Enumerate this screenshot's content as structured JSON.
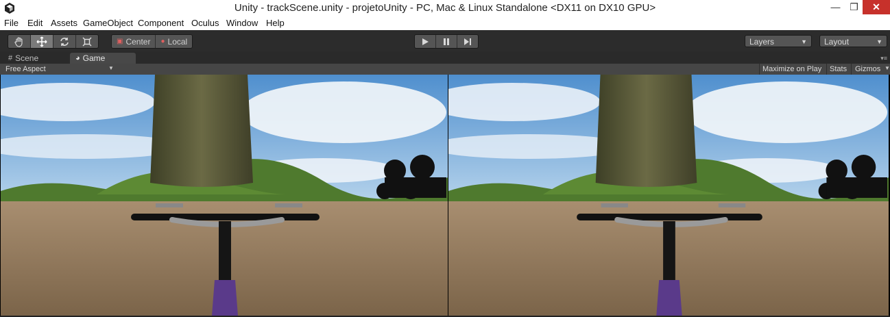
{
  "window": {
    "title": "Unity - trackScene.unity - projetoUnity - PC, Mac & Linux Standalone <DX11 on DX10 GPU>",
    "controls": [
      "minimize-icon",
      "maximize-icon",
      "close-icon"
    ]
  },
  "menu": {
    "items": [
      "File",
      "Edit",
      "Assets",
      "GameObject",
      "Component",
      "Oculus",
      "Window",
      "Help"
    ]
  },
  "toolbar": {
    "tools": [
      "hand-icon",
      "move-icon",
      "rotate-icon",
      "scale-icon"
    ],
    "active_tool": "move-icon",
    "pivot": "Center",
    "space": "Local",
    "playback": [
      "play-icon",
      "pause-icon",
      "step-icon"
    ],
    "layers": "Layers",
    "layout": "Layout"
  },
  "tabs": [
    {
      "label": "Scene",
      "icon": "grid-icon"
    },
    {
      "label": "Game",
      "icon": "pacman-icon"
    }
  ],
  "game": {
    "aspect": "Free Aspect",
    "maximize": "Maximize on Play",
    "stats": "Stats",
    "gizmos": "Gizmos"
  },
  "colors": {
    "sky_top": "#4f8fce",
    "sky_bottom": "#b7d4ec",
    "ground": "#8a7257",
    "hill": "#4f7a2e",
    "trunk": "#4e4e32",
    "fork": "#5a3a8a",
    "close": "#c7312b"
  }
}
